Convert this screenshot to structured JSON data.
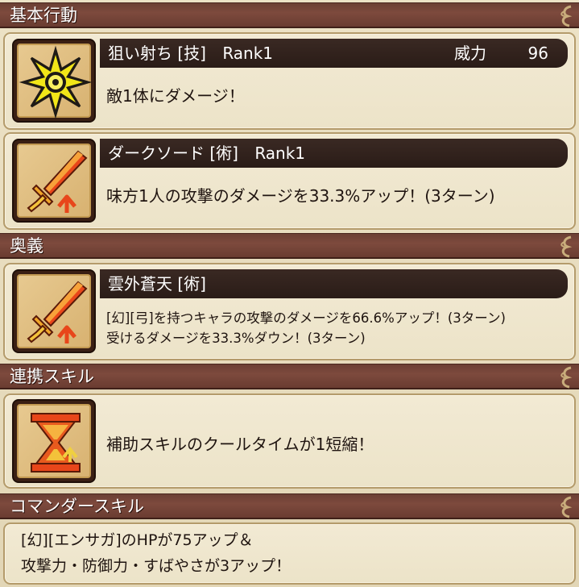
{
  "sections": {
    "basic": {
      "title": "基本行動"
    },
    "ougi": {
      "title": "奥義"
    },
    "link": {
      "title": "連携スキル"
    },
    "commander": {
      "title": "コマンダースキル"
    }
  },
  "basic_skills": [
    {
      "name": "狙い射ち [技]",
      "rank": "Rank1",
      "power_label": "威力",
      "power_value": "96",
      "description": "敵1体にダメージ！",
      "icon": "burst-star-icon"
    },
    {
      "name": "ダークソード [術]",
      "rank": "Rank1",
      "description": "味方1人の攻撃のダメージを33.3%アップ！(3ターン)",
      "icon": "sword-up-icon"
    }
  ],
  "ougi_skill": {
    "name": "雲外蒼天 [術]",
    "description_lines": [
      "[幻][弓]を持つキャラの攻撃のダメージを66.6%アップ！(3ターン)",
      "受けるダメージを33.3%ダウン！(3ターン)"
    ],
    "icon": "sword-up-icon"
  },
  "link_skill": {
    "description": "補助スキルのクールタイムが1短縮！",
    "icon": "hourglass-icon"
  },
  "commander_skill": {
    "description_lines": [
      "[幻][エンサガ]のHPが75アップ＆",
      "攻撃力・防御力・すばやさが3アップ！"
    ]
  },
  "colors": {
    "header_bg": "#6b3f34",
    "title_bar_bg": "#2a1c17",
    "card_bg": "#f2ead4",
    "card_border": "#b49b6b"
  }
}
